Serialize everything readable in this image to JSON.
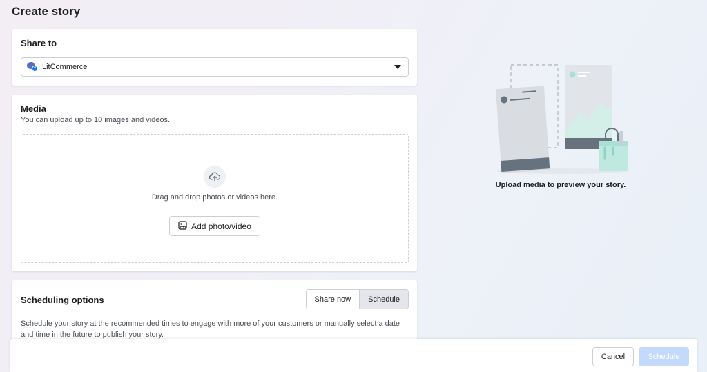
{
  "page": {
    "title": "Create story"
  },
  "share_to": {
    "heading": "Share to",
    "selected_account": "LitCommerce",
    "account_icon": "litcommerce-facebook-icon"
  },
  "media": {
    "heading": "Media",
    "subtitle": "You can upload up to 10 images and videos.",
    "drop_text": "Drag and drop photos or videos here.",
    "add_button": "Add photo/video"
  },
  "scheduling": {
    "heading": "Scheduling options",
    "options": [
      "Share now",
      "Schedule"
    ],
    "selected": "Schedule",
    "description": "Schedule your story at the recommended times to engage with more of your customers or manually select a date and time in the future to publish your story."
  },
  "preview": {
    "caption": "Upload media to preview your story."
  },
  "footer": {
    "cancel": "Cancel",
    "submit": "Schedule"
  },
  "colors": {
    "accent_disabled": "#c3dafc",
    "facebook_blue": "#1877f2",
    "mint": "#a8e0d4",
    "slate": "#6b7a88"
  }
}
